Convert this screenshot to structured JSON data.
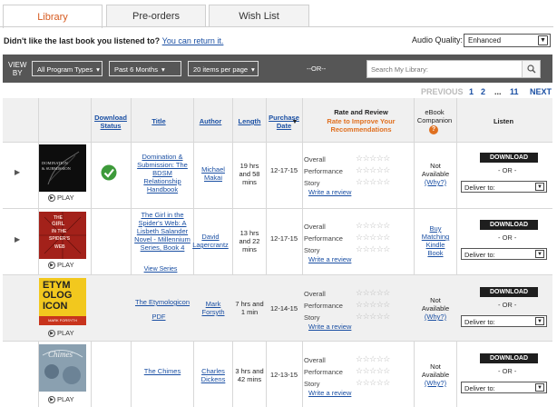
{
  "tabs": [
    {
      "label": "Library"
    },
    {
      "label": "Pre-orders"
    },
    {
      "label": "Wish List"
    }
  ],
  "return_text": "Didn't like the last book you listened to?",
  "return_link": "You can return it.",
  "audio_quality": {
    "label": "Audio Quality:",
    "value": "Enhanced"
  },
  "filters": {
    "view_by": [
      "VIEW",
      "BY"
    ],
    "program_types": "All Program Types",
    "period": "Past 6 Months",
    "per_page": "20 items per page",
    "or": "--OR--",
    "search_placeholder": "Search My Library:"
  },
  "pagination": {
    "previous": "PREVIOUS",
    "pages": [
      "1",
      "2",
      "...",
      "11"
    ],
    "next": "NEXT"
  },
  "columns": {
    "download_status": "Download Status",
    "title": "Title",
    "author": "Author",
    "length": "Length",
    "purchase_date": "Purchase Date",
    "rate_review": "Rate and Review",
    "rate_sub": "Rate to Improve Your Recommendations",
    "ebook": "eBook Companion",
    "listen": "Listen"
  },
  "labels": {
    "overall": "Overall",
    "performance": "Performance",
    "story": "Story",
    "write_review": "Write a review",
    "play": "PLAY",
    "download": "DOWNLOAD",
    "or": "- OR -",
    "deliver_to": "Deliver to:",
    "not_available": "Not Available",
    "why": "(Why?)"
  },
  "books": [
    {
      "title": "Domination & Submission: The BDSM Relationship Handbook",
      "author": "Michael Makai",
      "length": "19 hrs and 58 mins",
      "date": "12-17-15",
      "downloaded": true,
      "cover_text": [
        "DOMINATION",
        "& SUBMISSION"
      ],
      "ebook": "none"
    },
    {
      "title": "The Girl in the Spider's Web: A Lisbeth Salander Novel - Millennium Series, Book 4",
      "author": "David Lagercrantz",
      "length": "13 hrs and 22 mins",
      "date": "12-17-15",
      "downloaded": false,
      "view_series": "View Series",
      "cover_text": [
        "THE",
        "GIRL",
        "IN THE",
        "SPIDER'S",
        "WEB"
      ],
      "ebook": "Buy Matching Kindle Book"
    },
    {
      "title": "The Etymologicon",
      "pdf": "PDF",
      "author": "Mark Forsyth",
      "length": "7 hrs and 1 min",
      "date": "12-14-15",
      "downloaded": false,
      "cover_text": [
        "ETYM",
        "OLOG",
        "ICON",
        "MARK FORSYTH"
      ],
      "ebook": "none"
    },
    {
      "title": "The Chimes",
      "author": "Charles Dickens",
      "length": "3 hrs and 42 mins",
      "date": "12-13-15",
      "downloaded": false,
      "cover_text": [
        "Chimes"
      ],
      "ebook": "none"
    }
  ]
}
